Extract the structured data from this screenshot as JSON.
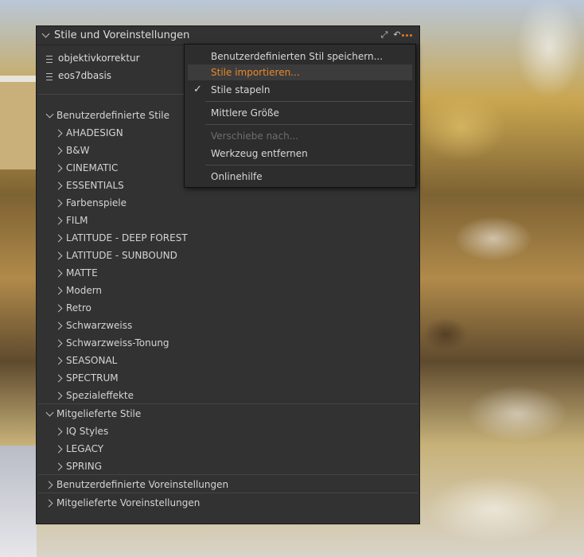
{
  "panel": {
    "title": "Stile und Voreinstellungen",
    "applied_styles": [
      "objektivkorrektur",
      "eos7dbasis"
    ],
    "groups": [
      {
        "label": "Benutzerdefinierte Stile",
        "expanded": true,
        "items": [
          "AHADESIGN",
          "B&W",
          "CINEMATIC",
          "ESSENTIALS",
          "Farbenspiele",
          "FILM",
          "LATITUDE - DEEP FOREST",
          "LATITUDE - SUNBOUND",
          "MATTE",
          "Modern",
          "Retro",
          "Schwarzweiss",
          "Schwarzweiss-Tonung",
          "SEASONAL",
          "SPECTRUM",
          "Spezialeffekte"
        ]
      },
      {
        "label": "Mitgelieferte Stile",
        "expanded": true,
        "items": [
          "IQ Styles",
          "LEGACY",
          "SPRING"
        ]
      },
      {
        "label": "Benutzerdefinierte Voreinstellungen",
        "expanded": false,
        "items": []
      },
      {
        "label": "Mitgelieferte Voreinstellungen",
        "expanded": false,
        "items": []
      }
    ],
    "header_icons": [
      "expand-icon",
      "reset-icon",
      "more-options-icon"
    ],
    "accent_color": "#e07a1f"
  },
  "menu": {
    "items": [
      {
        "label": "Benutzerdefinierten Stil speichern...",
        "state": "normal"
      },
      {
        "label": "Stile importieren...",
        "state": "highlighted"
      },
      {
        "label": "Stile stapeln",
        "state": "checked"
      },
      {
        "label": "Mittlere Größe",
        "state": "normal"
      },
      {
        "label": "Verschiebe nach...",
        "state": "disabled"
      },
      {
        "label": "Werkzeug entfernen",
        "state": "normal"
      },
      {
        "label": "Onlinehilfe",
        "state": "normal"
      }
    ],
    "check_glyph": "✓"
  }
}
